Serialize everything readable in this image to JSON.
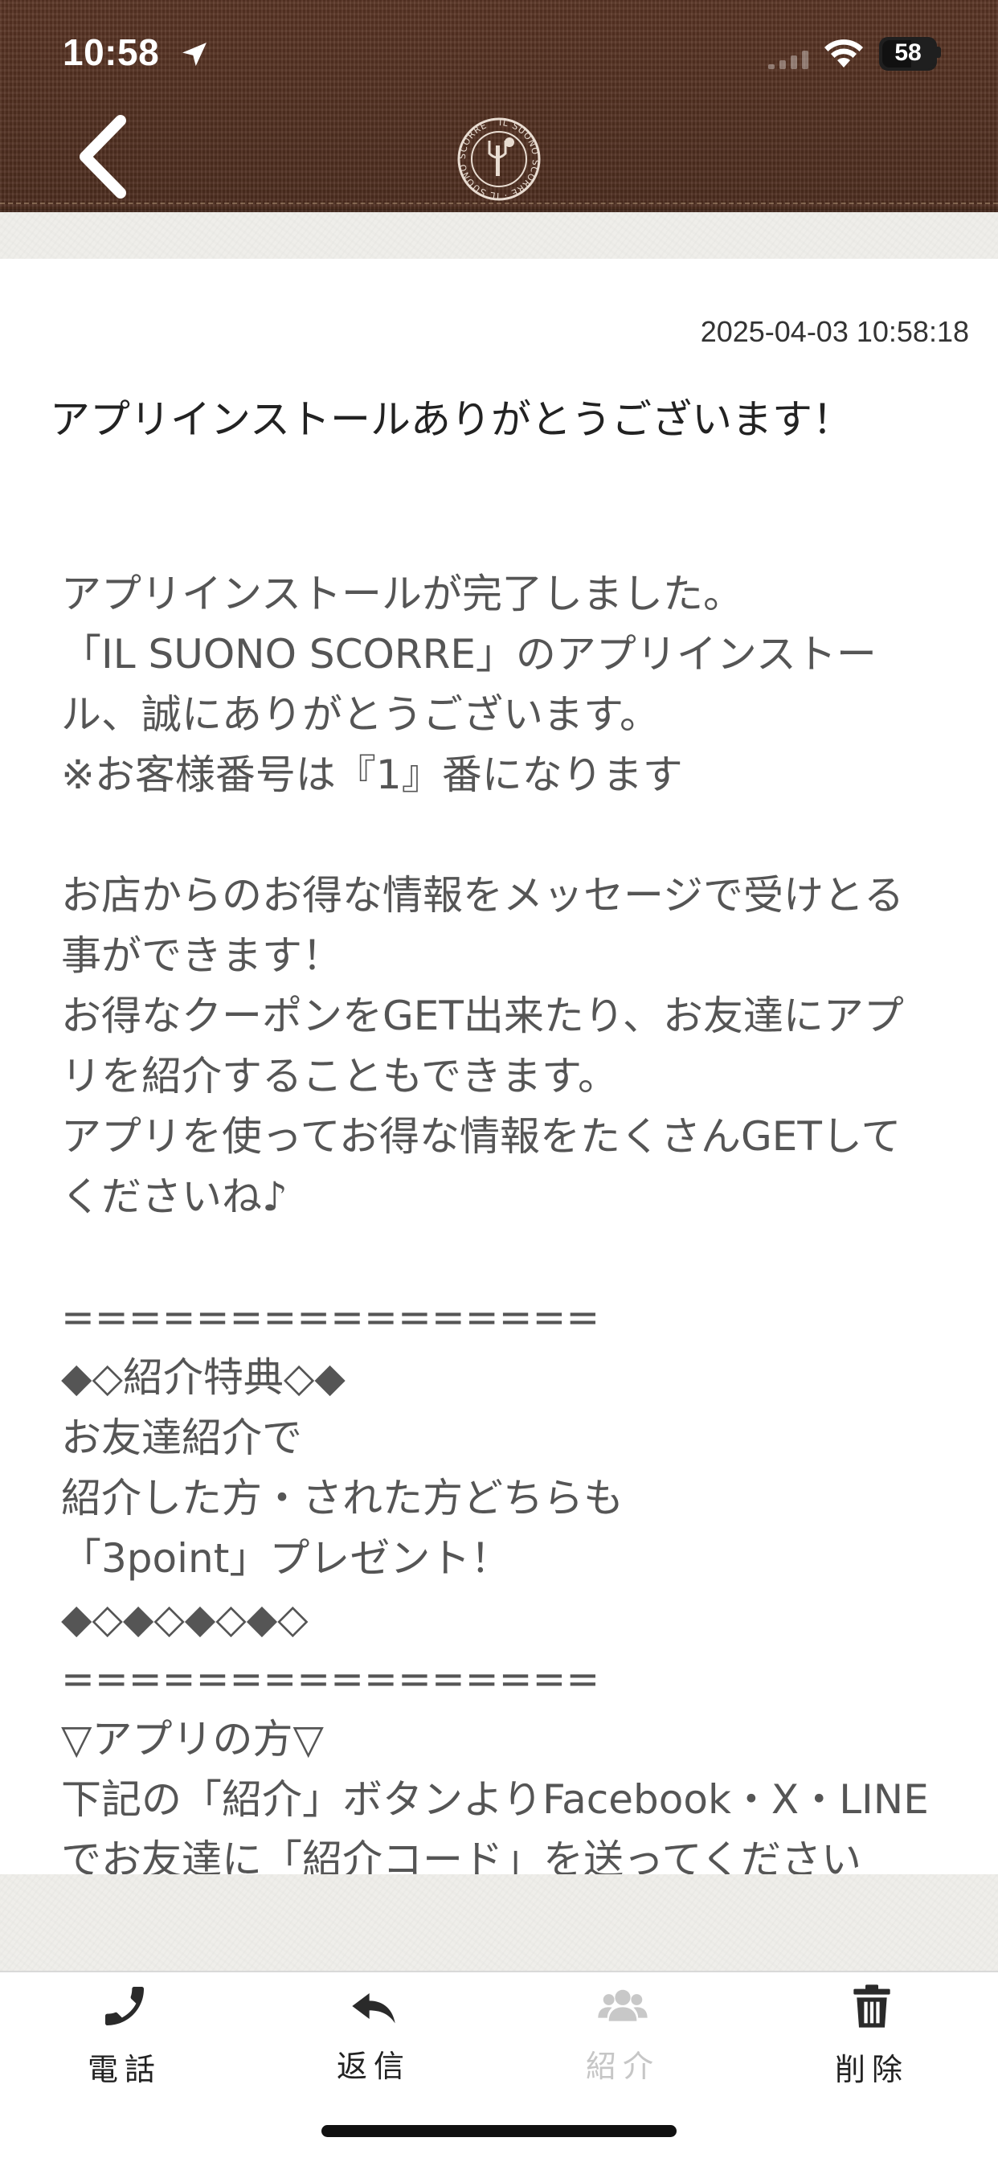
{
  "status_bar": {
    "time": "10:58",
    "battery": "58",
    "icons": [
      "location-arrow-icon",
      "cellular-signal-icon",
      "wifi-icon",
      "battery-icon"
    ]
  },
  "header": {
    "back_icon": "chevron-left-icon",
    "logo_text": "IL SUONO SCORRE",
    "colors": {
      "header_bg": "#4d2d1f",
      "paper_bg": "#efeeea"
    }
  },
  "message": {
    "timestamp": "2025-04-03 10:58:18",
    "title": "アプリインストールありがとうございます！",
    "body": "アプリインストールが完了しました。\n「IL SUONO SCORRE」のアプリインストー\nル、誠にありがとうございます。\n※お客様番号は『1』番になります\n\nお店からのお得な情報をメッセージで受けとる\n事ができます！\nお得なクーポンをGET出来たり、お友達にアプ\nリを紹介することもできます。\nアプリを使ってお得な情報をたくさんGETして\nくださいね♪\n\n================\n◆◇紹介特典◇◆\nお友達紹介で\n紹介した方・された方どちらも\n「3point」プレゼント！\n◆◇◆◇◆◇◆◇\n================\n▽アプリの方▽\n下記の「紹介」ボタンよりFacebook・X・LINE\nでお友達に「紹介コード」を送ってください"
  },
  "tabbar": {
    "items": [
      {
        "label": "電話",
        "icon": "phone-icon",
        "enabled": true
      },
      {
        "label": "返信",
        "icon": "reply-icon",
        "enabled": true
      },
      {
        "label": "紹介",
        "icon": "users-icon",
        "enabled": false
      },
      {
        "label": "削除",
        "icon": "trash-icon",
        "enabled": true
      }
    ]
  }
}
